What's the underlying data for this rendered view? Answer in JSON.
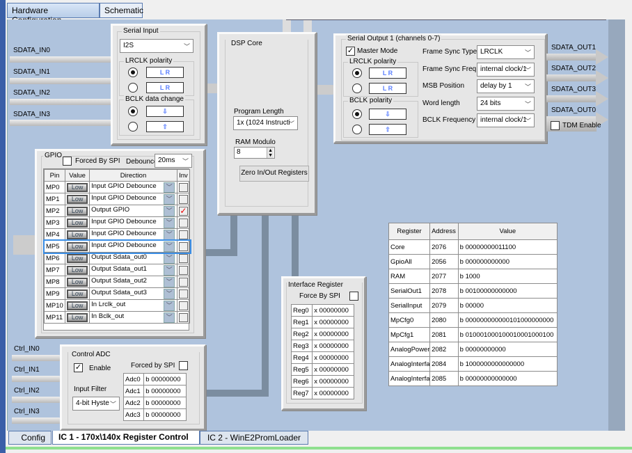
{
  "top_tabs": [
    "Hardware Configuration",
    "Schematic"
  ],
  "inputs": [
    "SDATA_IN0",
    "SDATA_IN1",
    "SDATA_IN2",
    "SDATA_IN3"
  ],
  "serial_input": {
    "title": "Serial Input",
    "mode": "I2S",
    "lrclk_title": "LRCLK polarity",
    "bclk_title": "BCLK data change",
    "wave_l": "L",
    "wave_r": "R",
    "down_arrow": "⇩",
    "up_arrow": "⇧"
  },
  "dsp": {
    "title": "DSP Core",
    "program_length_label": "Program Length",
    "program_length": "1x (1024 Instructi",
    "ram_modulo_label": "RAM Modulo",
    "ram_modulo": "8",
    "zero_button": "Zero In/Out Registers"
  },
  "serial_output": {
    "title": "Serial Output 1 (channels 0-7)",
    "master_mode": "Master Mode",
    "master_checked": true,
    "lrclk_title": "LRCLK polarity",
    "bclk_title": "BCLK polarity",
    "fields": [
      {
        "label": "Frame Sync Type",
        "value": "LRCLK"
      },
      {
        "label": "Frame Sync Freq.",
        "value": "internal clock/1"
      },
      {
        "label": "MSB Position",
        "value": "delay by 1"
      },
      {
        "label": "Word length",
        "value": "24 bits"
      },
      {
        "label": "BCLK Frequency",
        "value": "internal clock/1"
      }
    ]
  },
  "outputs": [
    "SDATA_OUT1",
    "SDATA_OUT2",
    "SDATA_OUT3",
    "SDATA_OUT0"
  ],
  "tdm_enable": "TDM Enable",
  "gpio": {
    "title": "GPIO",
    "forced_label": "Forced By SPI",
    "debounce_label": "Debounce",
    "debounce": "20ms",
    "headers": [
      "Pin",
      "Value",
      "Direction",
      "Inv"
    ],
    "rows": [
      {
        "pin": "MP0",
        "value": "Low",
        "dir": "Input  GPIO Debounce",
        "inv": false
      },
      {
        "pin": "MP1",
        "value": "Low",
        "dir": "Input  GPIO Debounce",
        "inv": false
      },
      {
        "pin": "MP2",
        "value": "Low",
        "dir": "Output GPIO",
        "inv": true
      },
      {
        "pin": "MP3",
        "value": "Low",
        "dir": "Input  GPIO Debounce",
        "inv": false
      },
      {
        "pin": "MP4",
        "value": "Low",
        "dir": "Input  GPIO Debounce",
        "inv": false
      },
      {
        "pin": "MP5",
        "value": "Low",
        "dir": "Input  GPIO Debounce",
        "inv": false
      },
      {
        "pin": "MP6",
        "value": "Low",
        "dir": "Output Sdata_out0",
        "inv": false
      },
      {
        "pin": "MP7",
        "value": "Low",
        "dir": "Output Sdata_out1",
        "inv": false
      },
      {
        "pin": "MP8",
        "value": "Low",
        "dir": "Output Sdata_out2",
        "inv": false
      },
      {
        "pin": "MP9",
        "value": "Low",
        "dir": "Output Sdata_out3",
        "inv": false
      },
      {
        "pin": "MP10",
        "value": "Low",
        "dir": "In Lrclk_out",
        "inv": false
      },
      {
        "pin": "MP11",
        "value": "Low",
        "dir": "In Bclk_out",
        "inv": false
      }
    ]
  },
  "ctrl_inputs": [
    "Ctrl_IN0",
    "Ctrl_IN1",
    "Ctrl_IN2",
    "Ctrl_IN3"
  ],
  "adc": {
    "title": "Control ADC",
    "enable": "Enable",
    "forced": "Forced by SPI",
    "filter_label": "Input Filter",
    "filter": "4-bit Hyste",
    "rows": [
      [
        "Adc0",
        "b 00000000"
      ],
      [
        "Adc1",
        "b 00000000"
      ],
      [
        "Adc2",
        "b 00000000"
      ],
      [
        "Adc3",
        "b 00000000"
      ]
    ]
  },
  "iface": {
    "title": "Interface Register",
    "forced": "Force By SPI",
    "rows": [
      [
        "Reg0",
        "x 00000000"
      ],
      [
        "Reg1",
        "x 00000000"
      ],
      [
        "Reg2",
        "x 00000000"
      ],
      [
        "Reg3",
        "x 00000000"
      ],
      [
        "Reg4",
        "x 00000000"
      ],
      [
        "Reg5",
        "x 00000000"
      ],
      [
        "Reg6",
        "x 00000000"
      ],
      [
        "Reg7",
        "x 00000000"
      ]
    ]
  },
  "registers": {
    "headers": [
      "Register",
      "Address",
      "Value"
    ],
    "rows": [
      [
        "Core",
        "2076",
        "b 00000000011100"
      ],
      [
        "GpioAll",
        "2056",
        "b 000000000000"
      ],
      [
        "RAM",
        "2077",
        "b 1000"
      ],
      [
        "SerialOut1",
        "2078",
        "b 00100000000000"
      ],
      [
        "SerialInput",
        "2079",
        "b 00000"
      ],
      [
        "MpCfg0",
        "2080",
        "b 000000000000101000000000"
      ],
      [
        "MpCfg1",
        "2081",
        "b 010001000100010001000100"
      ],
      [
        "AnalogPowerl",
        "2082",
        "b 00000000000"
      ],
      [
        "AnalogInterfa",
        "2084",
        "b 1000000000000000"
      ],
      [
        "AnalogInterfa",
        "2085",
        "b 00000000000000"
      ]
    ]
  },
  "bottom_tabs": [
    "Config",
    "IC 1 - 170x\\140x Register Control",
    "IC 2 - WinE2PromLoader"
  ]
}
